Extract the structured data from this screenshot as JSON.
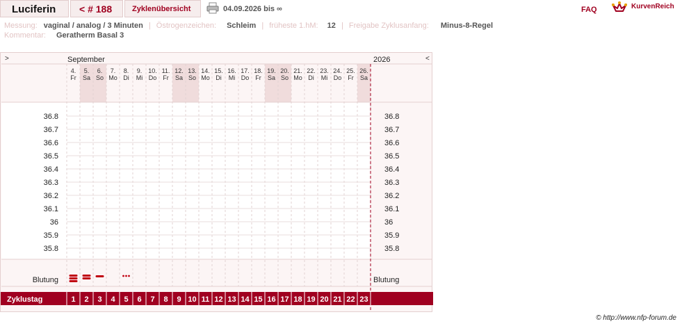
{
  "header": {
    "name": "Luciferin",
    "cycle": "< # 188",
    "overview": "Zyklenübersicht",
    "date_range": "04.09.2026 bis ∞",
    "faq": "FAQ",
    "logo_text": "KurvenReich"
  },
  "info": {
    "measurement_label": "Messung:",
    "measurement_value": "vaginal / analog / 3 Minuten",
    "estrogen_label": "Östrogenzeichen:",
    "estrogen_value": "Schleim",
    "earliest_label": "früheste 1.hM:",
    "earliest_value": "12",
    "release_label": "Freigabe Zyklusanfang:",
    "release_value": "Minus-8-Regel",
    "comment_label": "Kommentar:",
    "comment_value": "Geratherm Basal 3"
  },
  "chart": {
    "nav_left": ">",
    "nav_right": "<",
    "month": "September",
    "year": "2026",
    "days": [
      {
        "d": "4.",
        "w": "Fr",
        "weekend": false
      },
      {
        "d": "5.",
        "w": "Sa",
        "weekend": true
      },
      {
        "d": "6.",
        "w": "So",
        "weekend": true
      },
      {
        "d": "7.",
        "w": "Mo",
        "weekend": false
      },
      {
        "d": "8.",
        "w": "Di",
        "weekend": false
      },
      {
        "d": "9.",
        "w": "Mi",
        "weekend": false
      },
      {
        "d": "10.",
        "w": "Do",
        "weekend": false
      },
      {
        "d": "11.",
        "w": "Fr",
        "weekend": false
      },
      {
        "d": "12.",
        "w": "Sa",
        "weekend": true
      },
      {
        "d": "13.",
        "w": "So",
        "weekend": true
      },
      {
        "d": "14.",
        "w": "Mo",
        "weekend": false
      },
      {
        "d": "15.",
        "w": "Di",
        "weekend": false
      },
      {
        "d": "16.",
        "w": "Mi",
        "weekend": false
      },
      {
        "d": "17.",
        "w": "Do",
        "weekend": false
      },
      {
        "d": "18.",
        "w": "Fr",
        "weekend": false
      },
      {
        "d": "19.",
        "w": "Sa",
        "weekend": true
      },
      {
        "d": "20.",
        "w": "So",
        "weekend": true
      },
      {
        "d": "21.",
        "w": "Mo",
        "weekend": false
      },
      {
        "d": "22.",
        "w": "Di",
        "weekend": false
      },
      {
        "d": "23.",
        "w": "Mi",
        "weekend": false
      },
      {
        "d": "24.",
        "w": "Do",
        "weekend": false
      },
      {
        "d": "25.",
        "w": "Fr",
        "weekend": false
      },
      {
        "d": "26.",
        "w": "Sa",
        "weekend": true
      }
    ],
    "temps": [
      "36.8",
      "36.7",
      "36.6",
      "36.5",
      "36.4",
      "36.3",
      "36.2",
      "36.1",
      "36",
      "35.9",
      "35.8"
    ],
    "bleeding_label": "Blutung",
    "bleeding": [
      "heavy",
      "medium",
      "light",
      "",
      "spotting"
    ],
    "cycle_day_label": "Zyklustag",
    "cycle_days": [
      "1",
      "2",
      "3",
      "4",
      "5",
      "6",
      "7",
      "8",
      "9",
      "10",
      "11",
      "12",
      "13",
      "14",
      "15",
      "16",
      "17",
      "18",
      "19",
      "20",
      "21",
      "22",
      "23"
    ],
    "accent": "#a00020"
  },
  "footer": {
    "copyright": "© http://www.nfp-forum.de"
  }
}
